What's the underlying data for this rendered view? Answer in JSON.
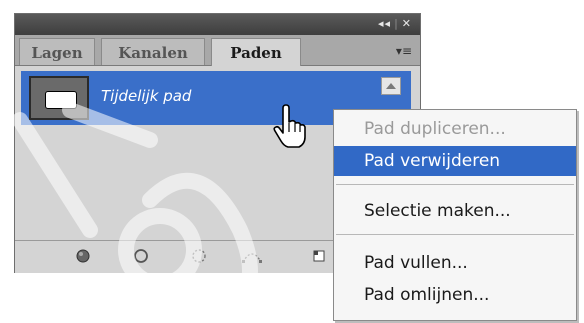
{
  "panel": {
    "title_controls": {
      "collapse": "◂◂",
      "close": "✕"
    },
    "tabs": [
      {
        "label": "Lagen",
        "active": false
      },
      {
        "label": "Kanalen",
        "active": false
      },
      {
        "label": "Paden",
        "active": true
      }
    ],
    "panel_menu_icon": "menu-lines-icon",
    "paths": [
      {
        "name": "Tijdelijk pad",
        "selected": true
      }
    ],
    "footer_icons": [
      "fill-path-icon",
      "stroke-path-icon",
      "load-selection-icon",
      "make-workpath-icon",
      "new-path-icon"
    ]
  },
  "context_menu": {
    "items": [
      {
        "label": "Pad dupliceren...",
        "state": "disabled"
      },
      {
        "label": "Pad verwijderen",
        "state": "highlighted"
      },
      {
        "label": "Selectie maken...",
        "state": "normal"
      },
      {
        "label": "Pad vullen...",
        "state": "normal"
      },
      {
        "label": "Pad omlijnen...",
        "state": "normal"
      }
    ]
  },
  "colors": {
    "selection": "#3a6fc9",
    "menu_highlight": "#3169c6",
    "panel_bg": "#d4d4d4",
    "titlebar": "#4a4a4a"
  }
}
